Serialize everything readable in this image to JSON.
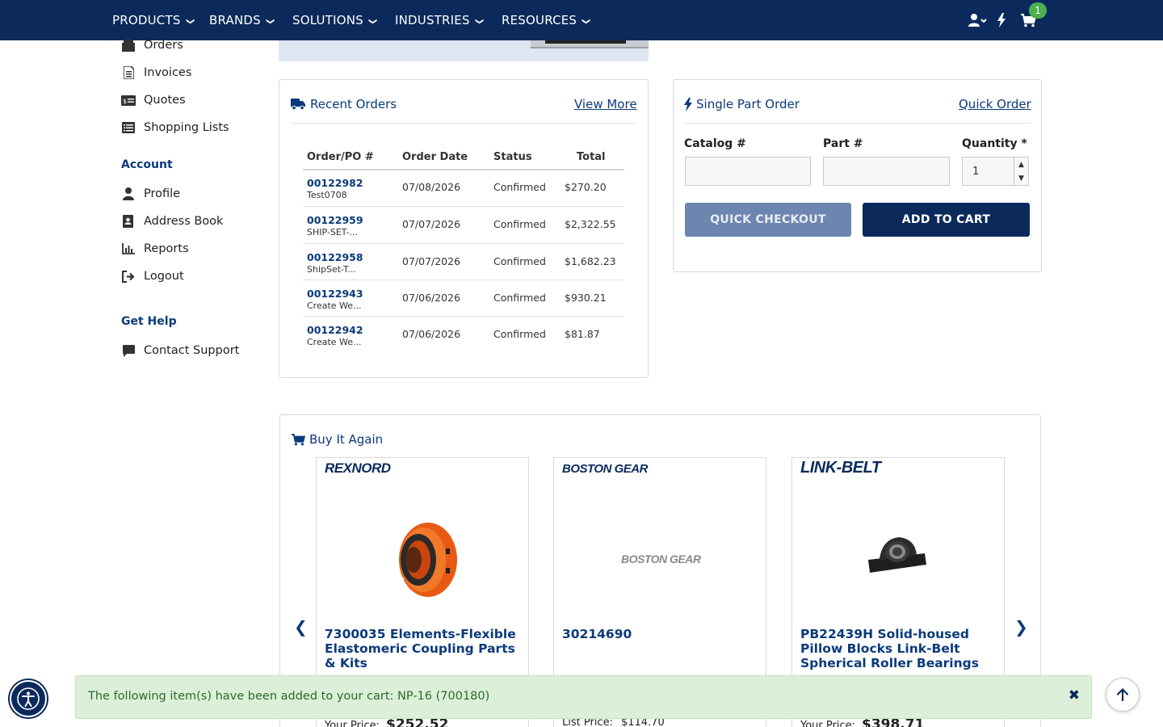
{
  "nav": {
    "items": [
      {
        "label": "PRODUCTS"
      },
      {
        "label": "BRANDS"
      },
      {
        "label": "SOLUTIONS"
      },
      {
        "label": "INDUSTRIES"
      },
      {
        "label": "RESOURCES"
      }
    ],
    "chevron": "⌄",
    "cart_count": "1",
    "icons": [
      "user-account-icon",
      "lightning-icon",
      "cart-icon"
    ]
  },
  "sidebar": {
    "orders_label": "Orders",
    "invoices_label": "Invoices",
    "quotes_label": "Quotes",
    "shopping_lists_label": "Shopping Lists",
    "account_heading": "Account",
    "profile_label": "Profile",
    "address_book_label": "Address Book",
    "reports_label": "Reports",
    "logout_label": "Logout",
    "help_heading": "Get Help",
    "contact_label": "Contact Support"
  },
  "recent_orders": {
    "title": "Recent Orders",
    "view_more": "View More",
    "headers": {
      "order": "Order/PO #",
      "date": "Order Date",
      "status": "Status",
      "total": "Total"
    },
    "rows": [
      {
        "order": "00122982",
        "po": "Test0708",
        "date": "07/08/2026",
        "status": "Confirmed",
        "total": "$270.20"
      },
      {
        "order": "00122959",
        "po": "SHIP-SET-...",
        "date": "07/07/2026",
        "status": "Confirmed",
        "total": "$2,322.55"
      },
      {
        "order": "00122958",
        "po": "ShipSet-T...",
        "date": "07/07/2026",
        "status": "Confirmed",
        "total": "$1,682.23"
      },
      {
        "order": "00122943",
        "po": "Create We...",
        "date": "07/06/2026",
        "status": "Confirmed",
        "total": "$930.21"
      },
      {
        "order": "00122942",
        "po": "Create We...",
        "date": "07/06/2026",
        "status": "Confirmed",
        "total": "$81.87"
      }
    ]
  },
  "single_part": {
    "title": "Single Part Order",
    "quick_order": "Quick Order",
    "catalog_label": "Catalog #",
    "catalog_value": "",
    "part_label": "Part #",
    "part_value": "",
    "quantity_label": "Quantity *",
    "quantity_value": "1",
    "quick_checkout": "QUICK CHECKOUT",
    "add_to_cart": "ADD TO CART"
  },
  "buy_again": {
    "title": "Buy It Again",
    "products": [
      {
        "brand": "REXNORD",
        "name": "7300035 Elements-Flexible Elastomeric Coupling Parts & Kits",
        "price_label": "Your Price:",
        "price": "$252.52"
      },
      {
        "brand": "BOSTON GEAR",
        "image_text": "BOSTON GEAR",
        "name": "30214690",
        "price_label": "List Price:",
        "price": "$114.70"
      },
      {
        "brand": "LINK-BELT",
        "name": "PB22439H Solid-housed Pillow Blocks Link-Belt Spherical Roller Bearings",
        "price_label": "Your Price:",
        "price": "$398.71"
      }
    ]
  },
  "toast": {
    "message": "The following item(s) have been added to your cart: NP-16 (700180)",
    "close": "✖"
  },
  "colors": {
    "navy": "#0b2a5b",
    "link_blue": "#0b3a7a",
    "success_bg": "#dcefd9",
    "badge_green": "#4caf50",
    "disabled_button": "#6d86b0"
  }
}
